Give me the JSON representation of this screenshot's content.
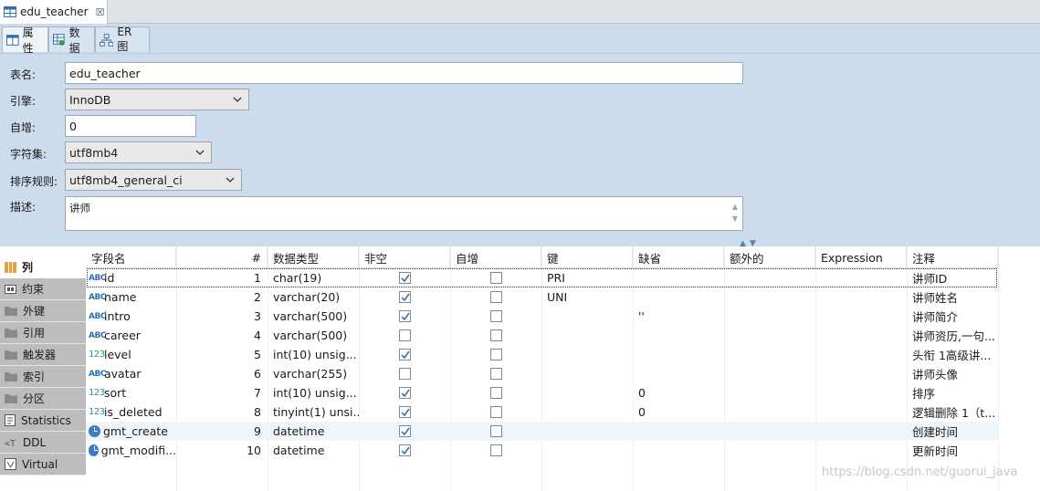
{
  "editor_tab": {
    "title": "edu_teacher",
    "close_glyph": "☒"
  },
  "subtabs": [
    {
      "label": "属性",
      "icon": "table-icon",
      "active": true
    },
    {
      "label": "数据",
      "icon": "data-grid-icon",
      "active": false
    },
    {
      "label": "ER 图",
      "icon": "er-diagram-icon",
      "active": false
    }
  ],
  "form": {
    "table_name_label": "表名:",
    "table_name_value": "edu_teacher",
    "engine_label": "引擎:",
    "engine_value": "InnoDB",
    "autoinc_label": "自增:",
    "autoinc_value": "0",
    "charset_label": "字符集:",
    "charset_value": "utf8mb4",
    "collation_label": "排序规则:",
    "collation_value": "utf8mb4_general_ci",
    "desc_label": "描述:",
    "desc_value": "讲师"
  },
  "sidebar": [
    {
      "label": "列",
      "icon": "columns-icon",
      "active": true
    },
    {
      "label": "约束",
      "icon": "constraint-icon",
      "active": false
    },
    {
      "label": "外键",
      "icon": "folder-icon",
      "active": false
    },
    {
      "label": "引用",
      "icon": "folder-icon",
      "active": false
    },
    {
      "label": "触发器",
      "icon": "folder-icon",
      "active": false
    },
    {
      "label": "索引",
      "icon": "folder-icon",
      "active": false
    },
    {
      "label": "分区",
      "icon": "folder-icon",
      "active": false
    },
    {
      "label": "Statistics",
      "icon": "statistics-icon",
      "active": false
    },
    {
      "label": "DDL",
      "icon": "ddl-icon",
      "active": false
    },
    {
      "label": "Virtual",
      "icon": "virtual-icon",
      "active": false
    }
  ],
  "columns_header": [
    "字段名",
    "#",
    "数据类型",
    "非空",
    "自增",
    "键",
    "缺省",
    "额外的",
    "Expression",
    "注释"
  ],
  "rows": [
    {
      "type_icon": "ABC",
      "name": "id",
      "num": "1",
      "dtype": "char(19)",
      "notnull": true,
      "autoinc": false,
      "key": "PRI",
      "default": "",
      "extra": "",
      "expr": "",
      "comment": "讲师ID"
    },
    {
      "type_icon": "ABC",
      "name": "name",
      "num": "2",
      "dtype": "varchar(20)",
      "notnull": true,
      "autoinc": false,
      "key": "UNI",
      "default": "",
      "extra": "",
      "expr": "",
      "comment": "讲师姓名"
    },
    {
      "type_icon": "ABC",
      "name": "intro",
      "num": "3",
      "dtype": "varchar(500)",
      "notnull": true,
      "autoinc": false,
      "key": "",
      "default": "''",
      "extra": "",
      "expr": "",
      "comment": "讲师简介"
    },
    {
      "type_icon": "ABC",
      "name": "career",
      "num": "4",
      "dtype": "varchar(500)",
      "notnull": false,
      "autoinc": false,
      "key": "",
      "default": "",
      "extra": "",
      "expr": "",
      "comment": "讲师资历,一句..."
    },
    {
      "type_icon": "123",
      "name": "level",
      "num": "5",
      "dtype": "int(10) unsig...",
      "notnull": true,
      "autoinc": false,
      "key": "",
      "default": "",
      "extra": "",
      "expr": "",
      "comment": "头衔 1高级讲..."
    },
    {
      "type_icon": "ABC",
      "name": "avatar",
      "num": "6",
      "dtype": "varchar(255)",
      "notnull": false,
      "autoinc": false,
      "key": "",
      "default": "",
      "extra": "",
      "expr": "",
      "comment": "讲师头像"
    },
    {
      "type_icon": "123",
      "name": "sort",
      "num": "7",
      "dtype": "int(10) unsig...",
      "notnull": true,
      "autoinc": false,
      "key": "",
      "default": "0",
      "extra": "",
      "expr": "",
      "comment": "排序"
    },
    {
      "type_icon": "123",
      "name": "is_deleted",
      "num": "8",
      "dtype": "tinyint(1) unsi...",
      "notnull": true,
      "autoinc": false,
      "key": "",
      "default": "0",
      "extra": "",
      "expr": "",
      "comment": "逻辑删除 1（t..."
    },
    {
      "type_icon": "clock",
      "name": "gmt_create",
      "num": "9",
      "dtype": "datetime",
      "notnull": true,
      "autoinc": false,
      "key": "",
      "default": "",
      "extra": "",
      "expr": "",
      "comment": "创建时间"
    },
    {
      "type_icon": "clock",
      "name": "gmt_modifi...",
      "num": "10",
      "dtype": "datetime",
      "notnull": true,
      "autoinc": false,
      "key": "",
      "default": "",
      "extra": "",
      "expr": "",
      "comment": "更新时间"
    }
  ],
  "watermark": "https://blog.csdn.net/guorui_java",
  "colors": {
    "panel_bg": "#ccdcec",
    "check": "#3b6fb0"
  }
}
